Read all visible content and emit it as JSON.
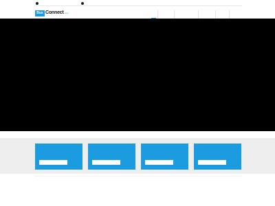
{
  "brand": {
    "logo_box_text": "Bus",
    "logo_text": "Connect",
    "logo_suffix": ".com"
  },
  "colors": {
    "accent": "#1b9be0",
    "hero_background": "#000000",
    "band_background": "#eeeeee"
  },
  "nav": {
    "items": [
      {
        "label": "",
        "active": true
      },
      {
        "label": "",
        "active": false
      },
      {
        "label": "",
        "active": false
      },
      {
        "label": "",
        "active": false
      },
      {
        "label": "",
        "active": false
      },
      {
        "label": "",
        "active": false
      }
    ]
  },
  "features": {
    "cards": [
      {
        "button_label": ""
      },
      {
        "button_label": ""
      },
      {
        "button_label": ""
      },
      {
        "button_label": ""
      }
    ]
  }
}
